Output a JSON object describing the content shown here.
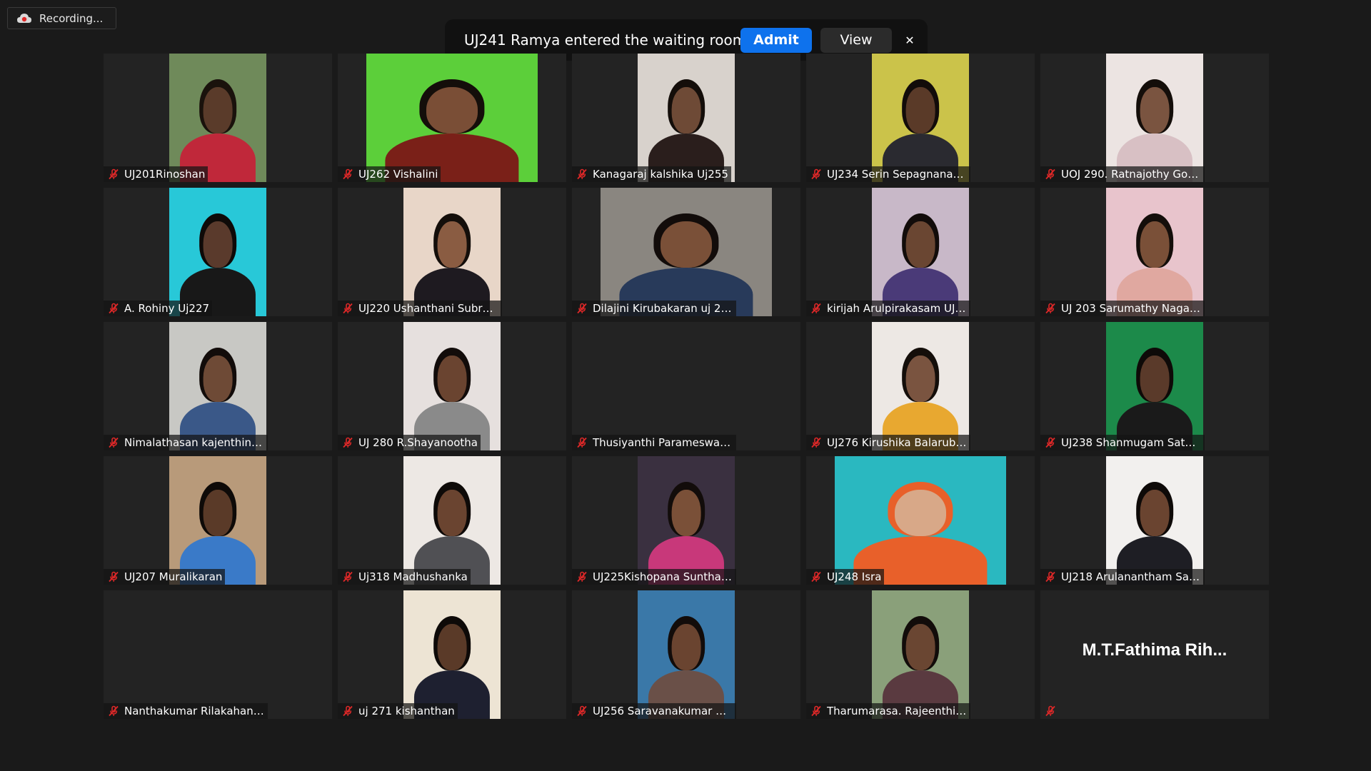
{
  "recording": {
    "label": "Recording..."
  },
  "banner": {
    "message": "UJ241 Ramya entered the waiting room",
    "admit_label": "Admit",
    "view_label": "View",
    "close_glyph": "✕"
  },
  "colors": {
    "admit_blue": "#0e72ed",
    "mic_muted_red": "#e02828",
    "background": "#1a1a1a",
    "tile": "#232323"
  },
  "participants": [
    {
      "name": "UJ201Rinoshan",
      "video": true,
      "bg": "#6f8a5a",
      "skin": "#5a3b2a",
      "cloth": "#c0283a",
      "hair": "#1a120c"
    },
    {
      "name": "UJ262 Vishalini",
      "video": true,
      "bg": "#5ccf3a",
      "skin": "#7a4e36",
      "cloth": "#7a2018",
      "hair": "#140e0a"
    },
    {
      "name": "Kanagaraj kalshika Uj255",
      "video": true,
      "bg": "#d8d2cc",
      "skin": "#6e4a36",
      "cloth": "#2a1e1c",
      "hair": "#140e0a"
    },
    {
      "name": "UJ234 Serin Sepagnanara...",
      "video": true,
      "bg": "#cbc34a",
      "skin": "#5a3a28",
      "cloth": "#2a2a30",
      "hair": "#120c0a"
    },
    {
      "name": "UOJ 290. Ratnajothy Gow...",
      "video": true,
      "bg": "#ece4e2",
      "skin": "#7a5440",
      "cloth": "#d8c0c4",
      "hair": "#140e0a"
    },
    {
      "name": "A. Rohiny Uj227",
      "video": true,
      "bg": "#28c8d8",
      "skin": "#5a3a2c",
      "cloth": "#181818",
      "hair": "#0e0a08"
    },
    {
      "name": "UJ220 Ushanthani Subra...",
      "video": true,
      "bg": "#e8d6c8",
      "skin": "#8a5c42",
      "cloth": "#1e1a20",
      "hair": "#140e0a"
    },
    {
      "name": "Dilajini Kirubakaran uj 272",
      "video": true,
      "bg": "#8a8680",
      "skin": "#7a5038",
      "cloth": "#283a5a",
      "hair": "#120c0a"
    },
    {
      "name": "kirijah Arulpirakasam UJ2...",
      "video": true,
      "bg": "#c8b8c8",
      "skin": "#6a4632",
      "cloth": "#4a3a78",
      "hair": "#120c0a"
    },
    {
      "name": "UJ 203 Sarumathy Nagar...",
      "video": true,
      "bg": "#e8c4cc",
      "skin": "#7a5038",
      "cloth": "#e0a8a0",
      "hair": "#140e0a"
    },
    {
      "name": "Nimalathasan kajenthini ...",
      "video": true,
      "bg": "#c8c8c4",
      "skin": "#6e4a36",
      "cloth": "#3a5888",
      "hair": "#120c0a"
    },
    {
      "name": "UJ 280 R.Shayanootha",
      "video": true,
      "bg": "#e6e0de",
      "skin": "#6a4430",
      "cloth": "#8a8a8a",
      "hair": "#120c0a"
    },
    {
      "name": "Thusiyanthi Parameswara...",
      "video": false
    },
    {
      "name": "UJ276  Kirushika Balaruban",
      "video": true,
      "bg": "#ede8e4",
      "skin": "#7a5440",
      "cloth": "#e8a830",
      "hair": "#140e0a"
    },
    {
      "name": "UJ238 Shanmugam Satha...",
      "video": true,
      "bg": "#1c8a4a",
      "skin": "#5a3a2a",
      "cloth": "#1a1a1a",
      "hair": "#0e0a08"
    },
    {
      "name": "UJ207 Muralikaran",
      "video": true,
      "bg": "#b89a7a",
      "skin": "#5a3a28",
      "cloth": "#3a7ac8",
      "hair": "#0e0a08"
    },
    {
      "name": "Uj318 Madhushanka",
      "video": true,
      "bg": "#ede8e4",
      "skin": "#6a4430",
      "cloth": "#505054",
      "hair": "#0e0a08"
    },
    {
      "name": "UJ225Kishopana Sunthar...",
      "video": true,
      "bg": "#3a3040",
      "skin": "#7a5038",
      "cloth": "#c8387a",
      "hair": "#120c0a"
    },
    {
      "name": "UJ248 Isra",
      "video": true,
      "bg": "#2ab8c0",
      "skin": "#d8a888",
      "cloth": "#e8602a",
      "hair": "#e8602a"
    },
    {
      "name": "UJ218 Arulanantham San...",
      "video": true,
      "bg": "#f2f0ee",
      "skin": "#6a4430",
      "cloth": "#1e1e24",
      "hair": "#0e0a08"
    },
    {
      "name": "Nanthakumar Rilakahana ...",
      "video": false
    },
    {
      "name": "uj 271 kishanthan",
      "video": true,
      "bg": "#ede4d4",
      "skin": "#5a3a28",
      "cloth": "#1e2030",
      "hair": "#0e0a08"
    },
    {
      "name": "UJ256 Saravanakumar Vi...",
      "video": true,
      "bg": "#3a78a8",
      "skin": "#6a4430",
      "cloth": "#6a5048",
      "hair": "#120c0a"
    },
    {
      "name": "Tharumarasa. Rajeenthini ...",
      "video": true,
      "bg": "#8aa07a",
      "skin": "#6a4632",
      "cloth": "#5a3a40",
      "hair": "#120c0a"
    },
    {
      "name": "",
      "video": false,
      "display_name": "M.T.Fathima  Rih..."
    }
  ]
}
